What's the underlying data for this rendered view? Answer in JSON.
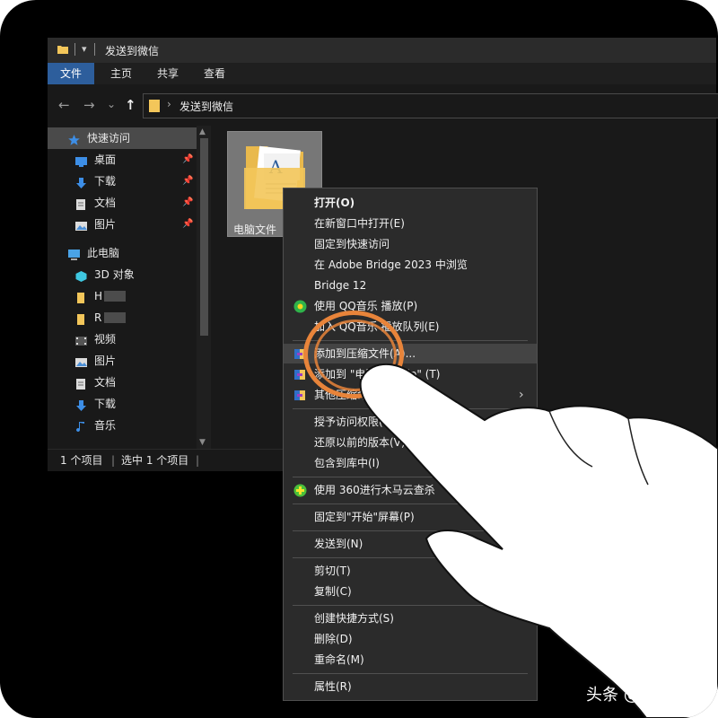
{
  "window": {
    "title": "发送到微信",
    "quick_access_toolbar": "▾"
  },
  "ribbon": {
    "tabs": [
      {
        "label": "文件",
        "active": true
      },
      {
        "label": "主页",
        "active": false
      },
      {
        "label": "共享",
        "active": false
      },
      {
        "label": "查看",
        "active": false
      }
    ]
  },
  "address_bar": {
    "back": "←",
    "forward": "→",
    "recent": "⌄",
    "up": "↑",
    "path": "发送到微信",
    "separator": "›"
  },
  "nav_pane": {
    "items": [
      {
        "label": "快速访问",
        "icon": "star-icon",
        "pinned": false
      },
      {
        "label": "桌面",
        "icon": "desktop-icon",
        "pinned": true
      },
      {
        "label": "下载",
        "icon": "download-icon",
        "pinned": true
      },
      {
        "label": "文档",
        "icon": "document-icon",
        "pinned": true
      },
      {
        "label": "图片",
        "icon": "picture-icon",
        "pinned": true
      },
      {
        "label": "此电脑",
        "icon": "computer-icon",
        "pinned": false
      },
      {
        "label": "3D 对象",
        "icon": "cube-3d-icon",
        "pinned": false
      },
      {
        "label": "H",
        "icon": "drive-icon",
        "pinned": false,
        "redacted": true
      },
      {
        "label": "R",
        "icon": "drive-icon",
        "pinned": false,
        "redacted": true
      },
      {
        "label": "视频",
        "icon": "video-icon",
        "pinned": false
      },
      {
        "label": "图片",
        "icon": "picture-icon",
        "pinned": false
      },
      {
        "label": "文档",
        "icon": "document-icon",
        "pinned": false
      },
      {
        "label": "下载",
        "icon": "download-icon",
        "pinned": false
      },
      {
        "label": "音乐",
        "icon": "music-icon",
        "pinned": false
      }
    ]
  },
  "content": {
    "file_name": "电脑文件"
  },
  "status_bar": {
    "item_count": "1 个项目",
    "selected_count": "选中 1 个项目"
  },
  "context_menu": {
    "groups": [
      [
        {
          "label": "打开(O)",
          "bold": true
        },
        {
          "label": "在新窗口中打开(E)"
        },
        {
          "label": "固定到快速访问"
        },
        {
          "label": "在 Adobe Bridge 2023 中浏览"
        },
        {
          "label": "Bridge 12"
        },
        {
          "label": "使用 QQ音乐 播放(P)",
          "icon": "qq-music-icon"
        },
        {
          "label": "加入 QQ音乐 播放队列(E)"
        }
      ],
      [
        {
          "label": "添加到压缩文件(A)...",
          "icon": "archive-icon",
          "highlighted": true
        },
        {
          "label": "添加到 \"电脑文件.zip\" (T)",
          "icon": "archive-icon"
        },
        {
          "label": "其他压缩命令",
          "icon": "archive-icon",
          "submenu": true
        }
      ],
      [
        {
          "label": "授予访问权限(G)",
          "submenu": true
        },
        {
          "label": "还原以前的版本(V)"
        },
        {
          "label": "包含到库中(I)",
          "submenu": true
        }
      ],
      [
        {
          "label": "使用 360进行木马云查杀",
          "icon": "360-antivirus-icon"
        }
      ],
      [
        {
          "label": "固定到\"开始\"屏幕(P)"
        }
      ],
      [
        {
          "label": "发送到(N)",
          "submenu": true
        }
      ],
      [
        {
          "label": "剪切(T)"
        },
        {
          "label": "复制(C)"
        }
      ],
      [
        {
          "label": "创建快捷方式(S)"
        },
        {
          "label": "删除(D)"
        },
        {
          "label": "重命名(M)"
        }
      ],
      [
        {
          "label": "属性(R)"
        }
      ]
    ]
  },
  "watermark": "头条 @舍记师",
  "colors": {
    "background": "#000000",
    "window": "#191919",
    "ribbon_active": "#2d5e9c",
    "menu_bg": "#2b2b2b",
    "menu_hover": "#444444",
    "annotation_ring": "#e8843a",
    "folder": "#f3c65a"
  }
}
